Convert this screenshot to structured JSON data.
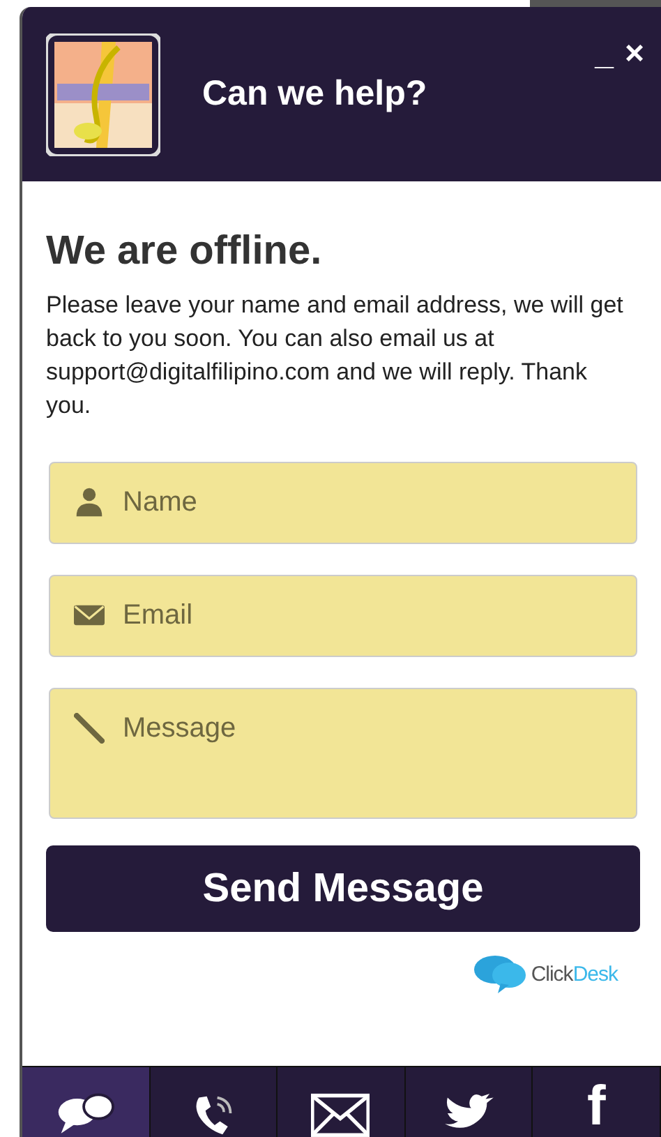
{
  "header": {
    "title": "Can we help?",
    "minimize": "_",
    "close": "×"
  },
  "status": {
    "heading": "We are offline.",
    "message": "Please leave your name and email address, we will get back to you soon. You can also email us at support@digitalfilipino.com and we will reply. Thank you."
  },
  "fields": [
    {
      "kind": "name",
      "placeholder": "Name"
    },
    {
      "kind": "email",
      "placeholder": "Email"
    },
    {
      "kind": "message",
      "placeholder": "Message"
    }
  ],
  "submit": "Send Message",
  "powered_by": {
    "prefix": "Click",
    "suffix": "Desk"
  },
  "tabs": [
    {
      "kind": "chat",
      "selected": true
    },
    {
      "kind": "phone",
      "selected": false
    },
    {
      "kind": "email",
      "selected": false
    },
    {
      "kind": "twitter",
      "selected": false
    },
    {
      "kind": "facebook",
      "label": "f",
      "selected": false
    }
  ]
}
